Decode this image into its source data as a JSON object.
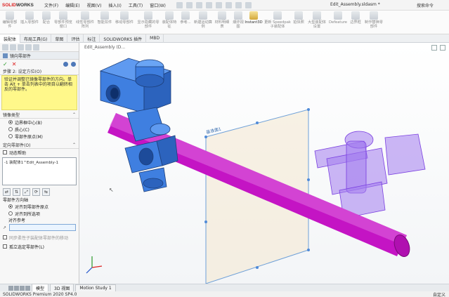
{
  "app": {
    "logo_prefix": "SOLID",
    "logo_suffix": "WORKS",
    "menu": [
      "文件(F)",
      "编辑(E)",
      "视图(V)",
      "插入(I)",
      "工具(T)",
      "窗口(W)"
    ],
    "document_title": "Edit_Assembly.sldasm *",
    "search_label": "搜索命令"
  },
  "ribbon": [
    {
      "label": "编辑零部件",
      "active": false
    },
    {
      "label": "插入零部件",
      "active": false
    },
    {
      "label": "配合",
      "active": false
    },
    {
      "label": "零部件预览窗口",
      "active": false
    },
    {
      "label": "线性零部件阵列",
      "active": false
    },
    {
      "label": "智能扣件",
      "active": false
    },
    {
      "label": "移动零部件",
      "active": false
    },
    {
      "label": "显示隐藏的零部件",
      "active": false
    },
    {
      "label": "装配体特征",
      "active": false
    },
    {
      "label": "参考...",
      "active": false
    },
    {
      "label": "新建运动算例",
      "active": false
    },
    {
      "label": "材料明细表",
      "active": false
    },
    {
      "label": "爆炸视图",
      "active": false
    },
    {
      "label": "Instant3D",
      "active": true
    },
    {
      "label": "更新 Speedpak 子装配体",
      "active": false
    },
    {
      "label": "拍快照",
      "active": false
    },
    {
      "label": "大型装配体设置",
      "active": false
    },
    {
      "label": "Defeature",
      "active": false
    },
    {
      "label": "边界框",
      "active": false
    },
    {
      "label": "制作替换零部件",
      "active": false
    }
  ],
  "command_tabs": [
    {
      "label": "装配体",
      "active": true
    },
    {
      "label": "布局工具(G)",
      "active": false
    },
    {
      "label": "草图",
      "active": false
    },
    {
      "label": "评估",
      "active": false
    },
    {
      "label": "标注",
      "active": false
    },
    {
      "label": "SOLIDWORKS 插件",
      "active": false
    },
    {
      "label": "MBD",
      "active": false
    }
  ],
  "panel": {
    "title": "镜向零部件",
    "step_title": "步骤 2: 设定方位(O)",
    "message": "验证并调整已镜像零部件的方向。单击 Alt + 单击列表中的项目以翻转相反的零部件。",
    "mirror_type_title": "镜像类型",
    "mirror_type_options": [
      {
        "label": "边界框中心(B)",
        "selected": true
      },
      {
        "label": "质心(C)",
        "selected": false
      },
      {
        "label": "零部件原点(M)",
        "selected": false
      }
    ],
    "oriented_title": "定向零部件(O)",
    "dynamic_help": "动态帮助",
    "list_item": "-1 装配体1^Edit_Assembly-1",
    "orientation_title": "零部件方向轴",
    "orientation_options": [
      {
        "label": "对齐到零部件原点",
        "selected": true
      },
      {
        "label": "对齐到所选项",
        "selected": false
      }
    ],
    "align_ref_label": "对齐参考",
    "sync_label": "同步柔性子装配体零部件的移动",
    "isolate_label": "孤立选定零部件(L)"
  },
  "viewport": {
    "breadcrumb": "Edit_Assembly (D...",
    "plane_label": "基准面1"
  },
  "bottom_tabs": [
    {
      "label": "模型",
      "active": true
    },
    {
      "label": "3D 视图",
      "active": false
    },
    {
      "label": "Motion Study 1",
      "active": false
    }
  ],
  "status": {
    "left": "SOLIDWORKS Premium 2020 SP4.0",
    "right": "自定义"
  },
  "colors": {
    "accent": "#4e78b8",
    "message_bg": "#fff88a",
    "blue_part": "#3f7fe0",
    "magenta_rod": "#c414c4",
    "ghost_purple": "#a27bef"
  }
}
